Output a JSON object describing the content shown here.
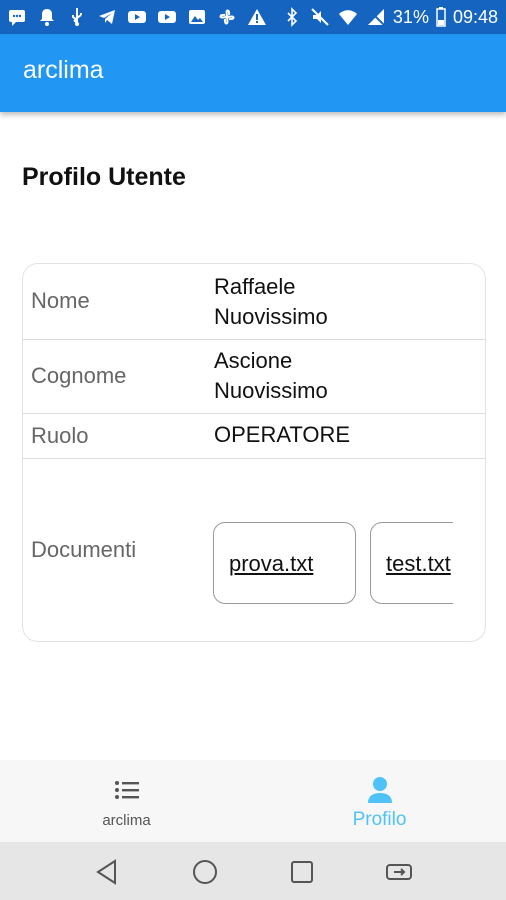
{
  "status_bar": {
    "battery": "31%",
    "time": "09:48"
  },
  "app_bar": {
    "title": "arclima"
  },
  "page": {
    "title": "Profilo Utente"
  },
  "profile": {
    "rows": [
      {
        "label": "Nome",
        "value_line1": "Raffaele",
        "value_line2": "Nuovissimo"
      },
      {
        "label": "Cognome",
        "value_line1": "Ascione",
        "value_line2": "Nuovissimo"
      },
      {
        "label": "Ruolo",
        "value": "OPERATORE"
      },
      {
        "label": "Documenti"
      }
    ],
    "documents": [
      "prova.txt",
      "test.txt"
    ]
  },
  "bottom_nav": {
    "items": [
      {
        "label": "arclima",
        "icon": "list-icon"
      },
      {
        "label": "Profilo",
        "icon": "person-icon",
        "active": true
      }
    ],
    "active_color": "#4fc3f7"
  },
  "colors": {
    "status_bar": "#1565c0",
    "app_bar": "#2196f3"
  }
}
